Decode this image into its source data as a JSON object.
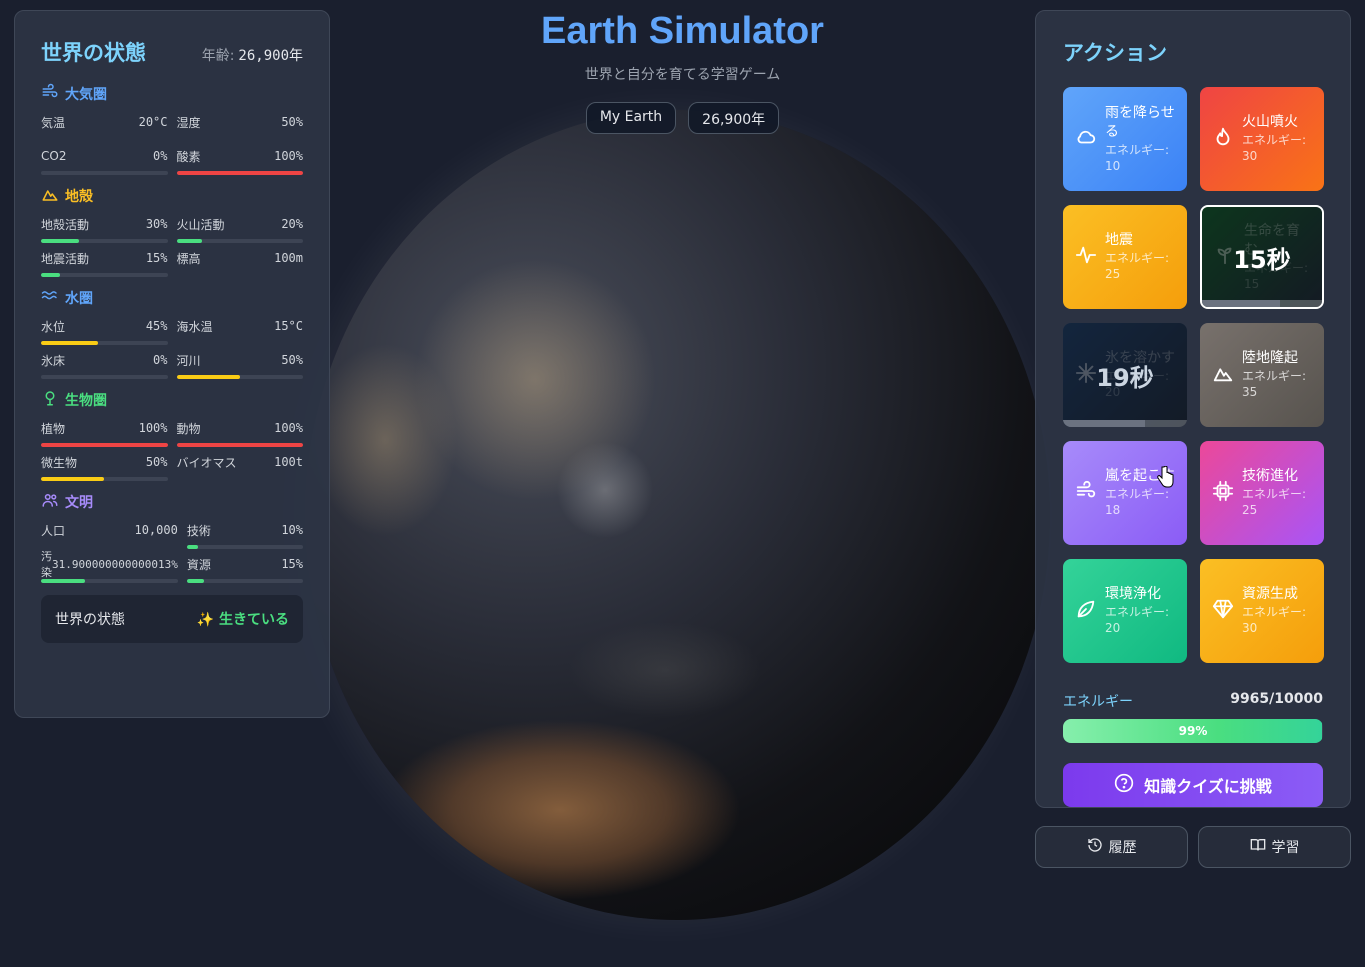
{
  "header": {
    "title": "Earth Simulator",
    "subtitle": "世界と自分を育てる学習ゲーム",
    "earth_name": "My Earth",
    "year": "26,900年"
  },
  "world": {
    "title": "世界の状態",
    "age_label": "年齢:",
    "age_value": "26,900年",
    "sections": [
      {
        "name": "大気圏",
        "color": "#60a5fa",
        "icon": "wind-icon",
        "stats": [
          {
            "label": "気温",
            "value": "20°C",
            "bar": null
          },
          {
            "label": "湿度",
            "value": "50%",
            "bar": null
          },
          {
            "label": "CO2",
            "value": "0%",
            "bar": 0,
            "bar_color": "#4ade80"
          },
          {
            "label": "酸素",
            "value": "100%",
            "bar": 1.0,
            "bar_color": "#ef4444"
          }
        ]
      },
      {
        "name": "地殻",
        "color": "#fbbf24",
        "icon": "mountain-icon",
        "stats": [
          {
            "label": "地殻活動",
            "value": "30%",
            "bar": 0.3,
            "bar_color": "#4ade80"
          },
          {
            "label": "火山活動",
            "value": "20%",
            "bar": 0.2,
            "bar_color": "#4ade80"
          },
          {
            "label": "地震活動",
            "value": "15%",
            "bar": 0.15,
            "bar_color": "#4ade80"
          },
          {
            "label": "標高",
            "value": "100m",
            "bar": null
          }
        ]
      },
      {
        "name": "水圏",
        "color": "#60a5fa",
        "icon": "waves-icon",
        "stats": [
          {
            "label": "水位",
            "value": "45%",
            "bar": 0.45,
            "bar_color": "#facc15"
          },
          {
            "label": "海水温",
            "value": "15°C",
            "bar": null
          },
          {
            "label": "氷床",
            "value": "0%",
            "bar": 0,
            "bar_color": "#4ade80"
          },
          {
            "label": "河川",
            "value": "50%",
            "bar": 0.5,
            "bar_color": "#facc15"
          }
        ]
      },
      {
        "name": "生物圏",
        "color": "#4ade80",
        "icon": "tree-icon",
        "stats": [
          {
            "label": "植物",
            "value": "100%",
            "bar": 1.0,
            "bar_color": "#ef4444"
          },
          {
            "label": "動物",
            "value": "100%",
            "bar": 1.0,
            "bar_color": "#ef4444"
          },
          {
            "label": "微生物",
            "value": "50%",
            "bar": 0.5,
            "bar_color": "#facc15"
          },
          {
            "label": "バイオマス",
            "value": "100t",
            "bar": null
          }
        ]
      },
      {
        "name": "文明",
        "color": "#a78bfa",
        "icon": "people-icon",
        "stats": [
          {
            "label": "人口",
            "value": "10,000",
            "bar": null
          },
          {
            "label": "技術",
            "value": "10%",
            "bar": 0.1,
            "bar_color": "#4ade80"
          },
          {
            "label": "汚染",
            "value": "31.900000000000013%",
            "bar": 0.319,
            "bar_color": "#4ade80"
          },
          {
            "label": "資源",
            "value": "15%",
            "bar": 0.15,
            "bar_color": "#4ade80"
          }
        ]
      }
    ],
    "status_label": "世界の状態",
    "status_value": "✨ 生きている"
  },
  "actions": {
    "title": "アクション",
    "items": [
      {
        "name": "雨を降らせる",
        "cost": "エネルギー: 10",
        "icon": "cloud-icon",
        "bg": "linear-gradient(135deg,#60a5fa,#3b82f6)"
      },
      {
        "name": "火山噴火",
        "cost": "エネルギー: 30",
        "icon": "flame-icon",
        "bg": "linear-gradient(135deg,#ef4444,#f97316)"
      },
      {
        "name": "地震",
        "cost": "エネルギー: 25",
        "icon": "pulse-icon",
        "bg": "linear-gradient(135deg,#fbbf24,#f59e0b)"
      },
      {
        "name": "生命を育む",
        "cost": "エネルギー: 15",
        "icon": "sprout-icon",
        "bg": "linear-gradient(135deg,#34d399,#059669)",
        "cooldown": "15秒",
        "cooldown_progress": 0.65
      },
      {
        "name": "氷を溶かす",
        "cost": "エネルギー: 20",
        "icon": "snowflake-icon",
        "bg": "linear-gradient(135deg,#38bdf8,#0284c7)",
        "cooldown": "19秒",
        "cooldown_progress": 0.66
      },
      {
        "name": "陸地隆起",
        "cost": "エネルギー: 35",
        "icon": "mountain-icon",
        "bg": "linear-gradient(135deg,#78716c,#57534e)"
      },
      {
        "name": "嵐を起こす",
        "cost": "エネルギー: 18",
        "icon": "wind-icon",
        "bg": "linear-gradient(135deg,#a78bfa,#8b5cf6)"
      },
      {
        "name": "技術進化",
        "cost": "エネルギー: 25",
        "icon": "chip-icon",
        "bg": "linear-gradient(135deg,#ec4899,#a855f7)"
      },
      {
        "name": "環境浄化",
        "cost": "エネルギー: 20",
        "icon": "leaf-icon",
        "bg": "linear-gradient(135deg,#34d399,#10b981)"
      },
      {
        "name": "資源生成",
        "cost": "エネルギー: 30",
        "icon": "gem-icon",
        "bg": "linear-gradient(135deg,#fbbf24,#f59e0b)"
      }
    ],
    "energy_label": "エネルギー",
    "energy_value": "9965/10000",
    "energy_fraction": 0.9965,
    "energy_pct": "99%",
    "quiz_label": "知識クイズに挑戦"
  },
  "footer": {
    "history_label": "履歴",
    "learn_label": "学習"
  }
}
